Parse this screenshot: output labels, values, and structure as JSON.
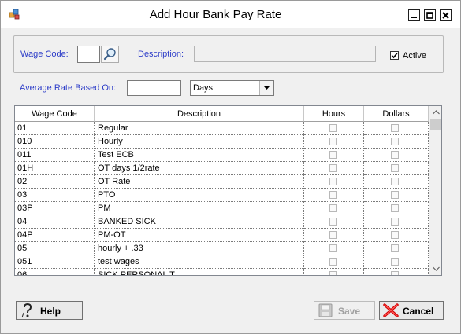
{
  "window": {
    "title": "Add Hour Bank Pay Rate"
  },
  "form": {
    "wage_code_label": "Wage Code:",
    "wage_code_value": "",
    "description_label": "Description:",
    "description_value": "",
    "active_label": "Active",
    "active_checked": true,
    "avg_rate_label": "Average Rate Based On:",
    "avg_rate_value": "",
    "period_selected": "Days"
  },
  "grid": {
    "columns": [
      "Wage Code",
      "Description",
      "Hours",
      "Dollars"
    ],
    "rows": [
      {
        "code": "01",
        "desc": "Regular"
      },
      {
        "code": "010",
        "desc": "Hourly"
      },
      {
        "code": "011",
        "desc": "Test ECB"
      },
      {
        "code": "01H",
        "desc": "OT days 1/2rate"
      },
      {
        "code": "02",
        "desc": "OT Rate"
      },
      {
        "code": "03",
        "desc": "PTO"
      },
      {
        "code": "03P",
        "desc": "PM"
      },
      {
        "code": "04",
        "desc": "BANKED SICK"
      },
      {
        "code": "04P",
        "desc": "PM-OT"
      },
      {
        "code": "05",
        "desc": "hourly + .33"
      },
      {
        "code": "051",
        "desc": "test wages"
      },
      {
        "code": "06",
        "desc": "SICK PERSONAL T"
      }
    ]
  },
  "buttons": {
    "help": "Help",
    "save": "Save",
    "cancel": "Cancel"
  },
  "colors": {
    "label_blue": "#2c3cc8",
    "cancel_x": "#d40000"
  }
}
